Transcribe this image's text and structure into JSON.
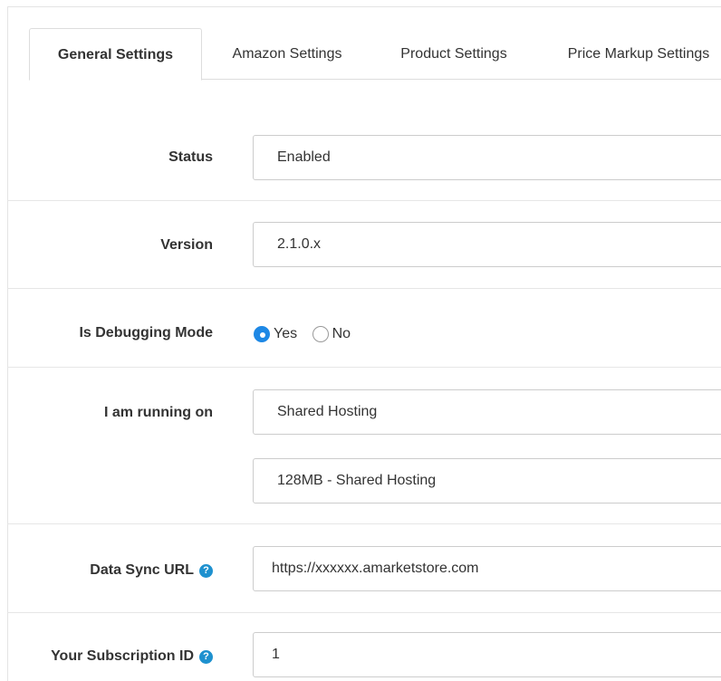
{
  "tabs": [
    {
      "label": "General Settings",
      "active": true
    },
    {
      "label": "Amazon Settings",
      "active": false
    },
    {
      "label": "Product Settings",
      "active": false
    },
    {
      "label": "Price Markup Settings",
      "active": false
    }
  ],
  "status": {
    "label": "Status",
    "value": "Enabled"
  },
  "version": {
    "label": "Version",
    "value": "2.1.0.x"
  },
  "debugging": {
    "label": "Is Debugging Mode",
    "options": [
      {
        "label": "Yes",
        "checked": true
      },
      {
        "label": "No",
        "checked": false
      }
    ]
  },
  "running_on": {
    "label": "I am running on",
    "hosting_value": "Shared Hosting",
    "memory_value": "128MB - Shared Hosting"
  },
  "data_sync_url": {
    "label": "Data Sync URL",
    "value": "https://xxxxxx.amarketstore.com",
    "help_icon": "question-circle-icon"
  },
  "subscription_id": {
    "label": "Your Subscription ID",
    "value": "1",
    "help_icon": "question-circle-icon"
  },
  "colors": {
    "accent": "#1e88e5",
    "help": "#1e91cf",
    "border": "#cccccc"
  }
}
